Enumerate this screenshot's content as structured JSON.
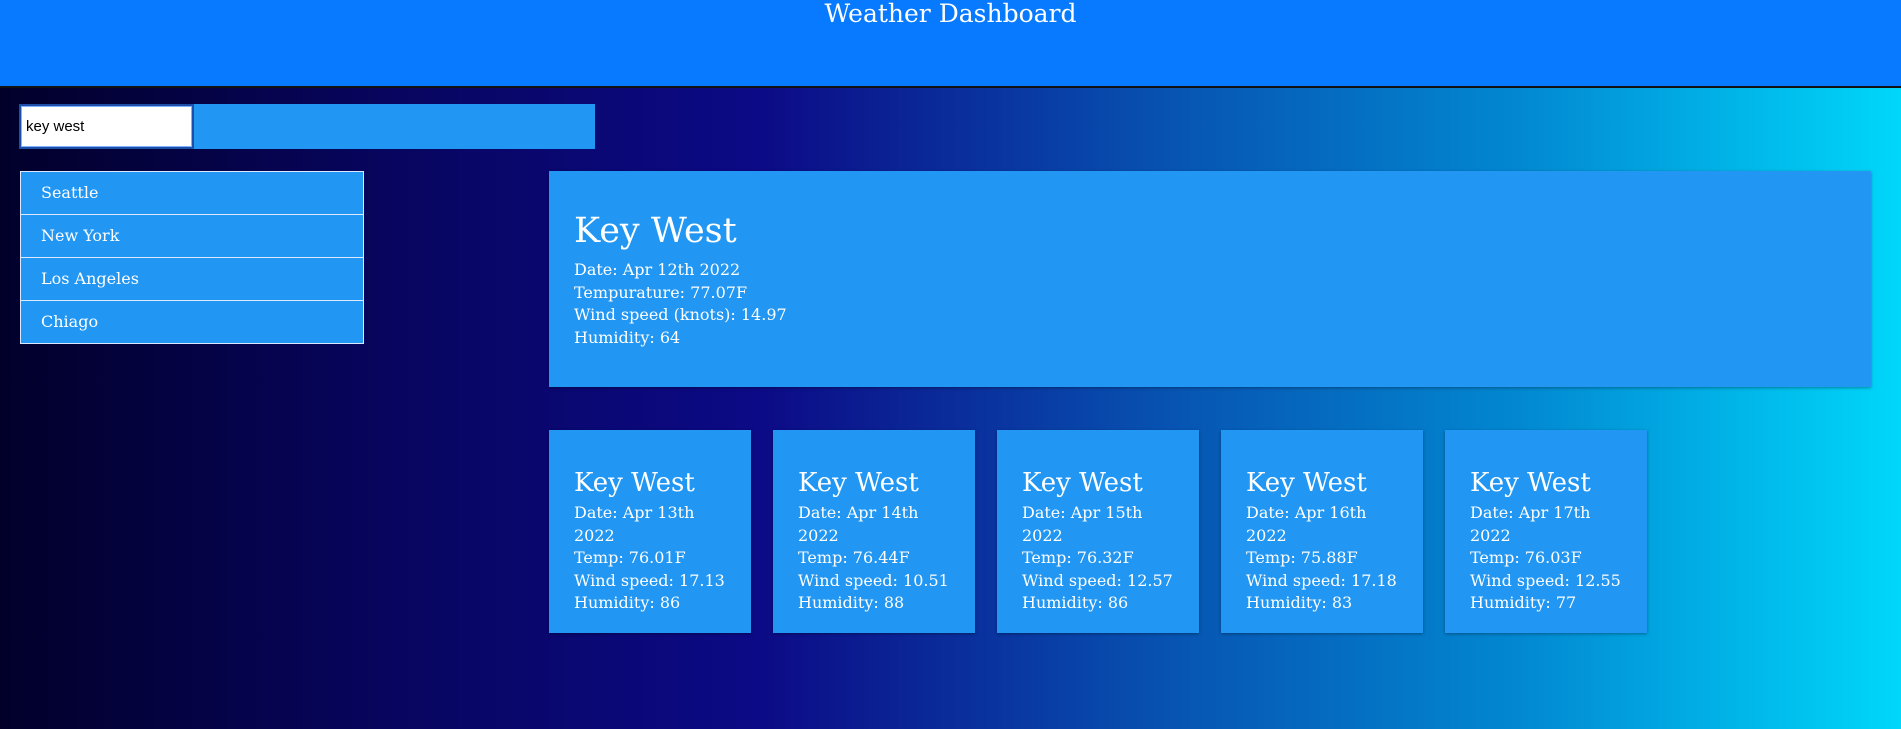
{
  "header": {
    "title": "Weather Dashboard"
  },
  "search": {
    "value": "key west",
    "button_label": ""
  },
  "history": [
    {
      "label": "Seattle"
    },
    {
      "label": "New York"
    },
    {
      "label": "Los Angeles"
    },
    {
      "label": "Chiago"
    }
  ],
  "current": {
    "city": "Key West",
    "date": "Date: Apr 12th 2022",
    "temp": "Tempurature: 77.07F",
    "wind": "Wind speed (knots): 14.97",
    "humidity": "Humidity: 64"
  },
  "forecast": [
    {
      "city": "Key West",
      "date": "Date: Apr 13th 2022",
      "temp": "Temp: 76.01F",
      "wind": "Wind speed: 17.13",
      "humidity": "Humidity: 86"
    },
    {
      "city": "Key West",
      "date": "Date: Apr 14th 2022",
      "temp": "Temp: 76.44F",
      "wind": "Wind speed: 10.51",
      "humidity": "Humidity: 88"
    },
    {
      "city": "Key West",
      "date": "Date: Apr 15th 2022",
      "temp": "Temp: 76.32F",
      "wind": "Wind speed: 12.57",
      "humidity": "Humidity: 86"
    },
    {
      "city": "Key West",
      "date": "Date: Apr 16th 2022",
      "temp": "Temp: 75.88F",
      "wind": "Wind speed: 17.18",
      "humidity": "Humidity: 83"
    },
    {
      "city": "Key West",
      "date": "Date: Apr 17th 2022",
      "temp": "Temp: 76.03F",
      "wind": "Wind speed: 12.55",
      "humidity": "Humidity: 77"
    }
  ],
  "colors": {
    "header_bg": "#077aff",
    "card_bg": "#2196f3",
    "text": "#ffffff"
  }
}
